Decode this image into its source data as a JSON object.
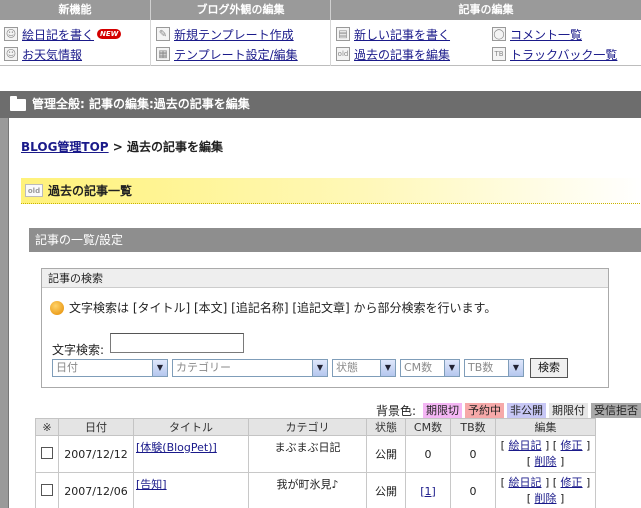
{
  "topnav": {
    "headers": [
      "新機能",
      "ブログ外観の編集",
      "記事の編集"
    ],
    "links": [
      {
        "label": "絵日記を書く",
        "icon": "person-icon",
        "badge": "NEW"
      },
      {
        "label": "お天気情報",
        "icon": "person-icon"
      },
      {
        "label": "新規テンプレート作成",
        "icon": "pencil-icon"
      },
      {
        "label": "テンプレート設定/編集",
        "icon": "template-icon"
      },
      {
        "label": "新しい記事を書く",
        "icon": "document-icon"
      },
      {
        "label": "過去の記事を編集",
        "icon": "old-icon",
        "icon_text": "old"
      },
      {
        "label": "コメント一覧",
        "icon": "comment-icon"
      },
      {
        "label": "トラックバック一覧",
        "icon": "trackback-icon",
        "icon_text": "TB"
      }
    ]
  },
  "page_title": "管理全般: 記事の編集:過去の記事を編集",
  "breadcrumb": {
    "root": "BLOG管理TOP",
    "separator": ">",
    "current": "過去の記事を編集"
  },
  "list_heading": {
    "label": "過去の記事一覧",
    "icon_text": "old"
  },
  "section_title": "記事の一覧/設定",
  "search": {
    "title": "記事の検索",
    "info": "文字検索は [タイトル] [本文] [追記名称] [追記文章] から部分検索を行います。",
    "text_label": "文字検索:",
    "text_value": "",
    "selects": [
      "日付",
      "カテゴリー",
      "状態",
      "CM数",
      "TB数"
    ],
    "button": "検索"
  },
  "legend": {
    "label": "背景色:",
    "items": [
      {
        "label": "期限切",
        "color": "#f4b6f4"
      },
      {
        "label": "予約中",
        "color": "#f6a9a9"
      },
      {
        "label": "非公開",
        "color": "#c7c7f5"
      },
      {
        "label": "期限付",
        "color": "#e6e6e6"
      },
      {
        "label": "受信拒否",
        "color": "#a9a9a9"
      }
    ]
  },
  "table": {
    "headers": [
      "※",
      "日付",
      "タイトル",
      "カテゴリ",
      "状態",
      "CM数",
      "TB数",
      "編集"
    ],
    "rows": [
      {
        "date": "2007/12/12",
        "title": "[体験(BlogPet)]",
        "category": "まぶまぶ日記",
        "status": "公開",
        "cm": "0",
        "tb": "0",
        "edit1": "絵日記",
        "edit2": "修正",
        "edit3": "削除"
      },
      {
        "date": "2007/12/06",
        "title": "[告知]",
        "category": "我が町氷見♪",
        "status": "公開",
        "cm": "[1]",
        "tb": "0",
        "edit1": "絵日記",
        "edit2": "修正",
        "edit3": "削除"
      }
    ]
  }
}
